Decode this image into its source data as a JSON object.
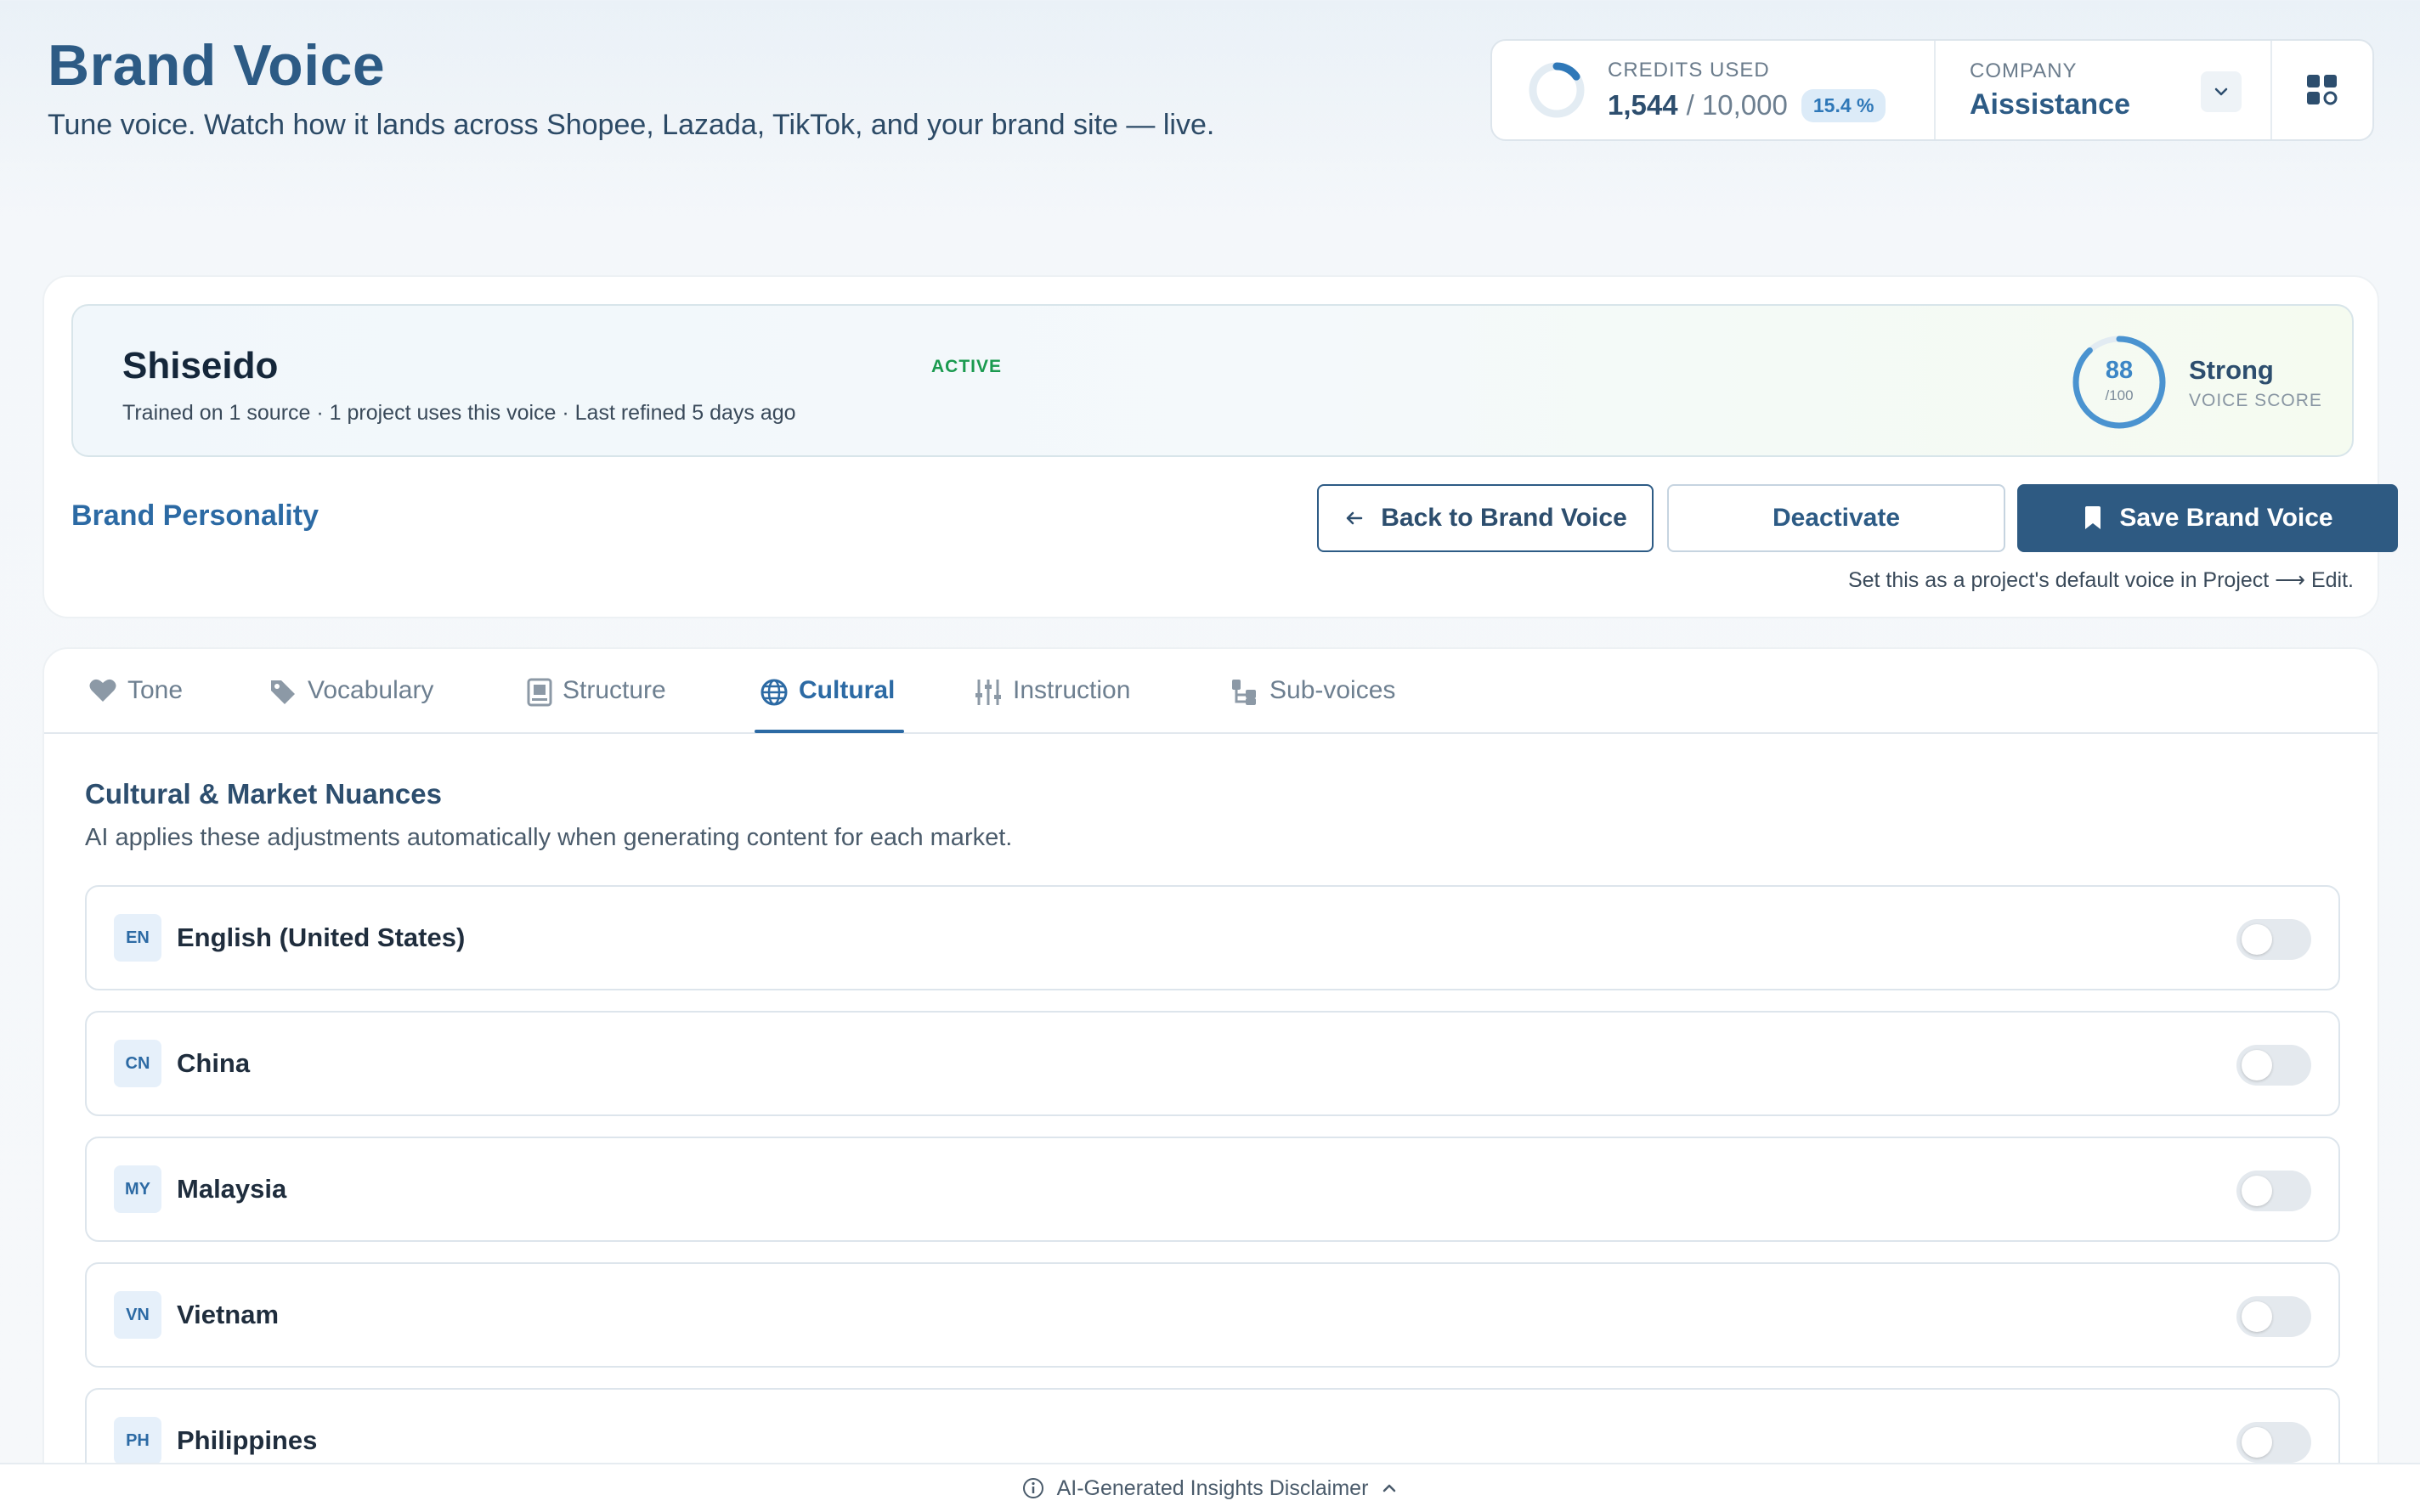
{
  "header": {
    "title": "Brand Voice",
    "subtitle": "Tune voice. Watch how it lands across Shopee, Lazada, TikTok, and your brand site — live."
  },
  "credits": {
    "label": "CREDITS USED",
    "used": "1,544",
    "total": "/ 10,000",
    "percent": "15.4 %",
    "fraction": 0.154
  },
  "company": {
    "label": "COMPANY",
    "name": "Aissistance"
  },
  "voice": {
    "name": "Shiseido",
    "status": "ACTIVE",
    "meta": "Trained on 1 source · 1 project uses this voice · Last refined 5 days ago",
    "score": "88",
    "score_max": "/100",
    "score_value": 88,
    "score_label": "Strong",
    "score_sub": "VOICE SCORE"
  },
  "actions": {
    "section_label": "Brand Personality",
    "back": "Back to Brand Voice",
    "deactivate": "Deactivate",
    "save": "Save Brand Voice",
    "hint": "Set this as a project's default voice in Project ⟶ Edit."
  },
  "tabs": [
    {
      "label": "Tone",
      "icon": "heart-icon"
    },
    {
      "label": "Vocabulary",
      "icon": "tag-icon"
    },
    {
      "label": "Structure",
      "icon": "structure-icon"
    },
    {
      "label": "Cultural",
      "icon": "globe-icon",
      "active": true
    },
    {
      "label": "Instruction",
      "icon": "sliders-icon"
    },
    {
      "label": "Sub-voices",
      "icon": "hierarchy-icon"
    }
  ],
  "cultural": {
    "title": "Cultural & Market Nuances",
    "description": "AI applies these adjustments automatically when generating content for each market.",
    "markets": [
      {
        "code": "EN",
        "name": "English (United States)",
        "enabled": false
      },
      {
        "code": "CN",
        "name": "China",
        "enabled": false
      },
      {
        "code": "MY",
        "name": "Malaysia",
        "enabled": false
      },
      {
        "code": "VN",
        "name": "Vietnam",
        "enabled": false
      },
      {
        "code": "PH",
        "name": "Philippines",
        "enabled": false
      }
    ]
  },
  "footer": {
    "disclaimer": "AI-Generated Insights Disclaimer"
  },
  "colors": {
    "primary": "#2d5b85",
    "accent": "#2c6aa4",
    "active_status": "#1a9a4f",
    "score_ring": "#4a93d0"
  }
}
